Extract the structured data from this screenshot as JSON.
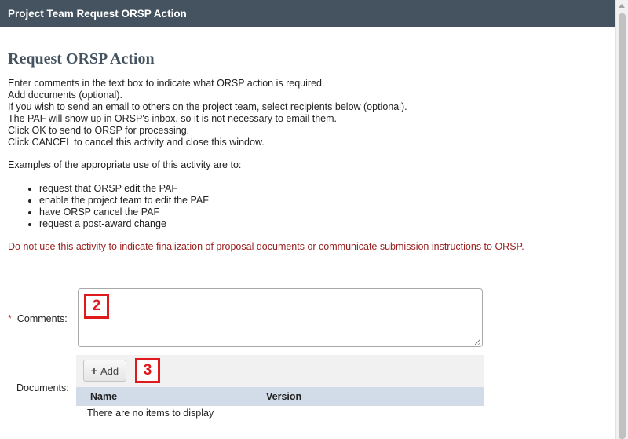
{
  "window": {
    "title": "Project Team Request ORSP Action"
  },
  "page": {
    "heading": "Request ORSP Action",
    "instructions": [
      "Enter comments in the text box to indicate what ORSP action is required.",
      "Add documents (optional).",
      "If you wish to send an email to others on the project team, select recipients below (optional).",
      "The PAF will show up in ORSP's inbox, so it is not necessary to email them.",
      "Click OK to send to ORSP for processing.",
      "Click CANCEL to cancel this activity and close this window."
    ],
    "examples_intro": "Examples of the appropriate use of this activity are to:",
    "examples": [
      "request that ORSP edit the PAF",
      "enable the project team to edit the PAF",
      "have ORSP cancel the PAF",
      "request a post-award change"
    ],
    "warning": "Do not use this activity to indicate finalization of proposal documents or communicate submission instructions to ORSP."
  },
  "form": {
    "comments": {
      "required_marker": "*",
      "label": "Comments:",
      "value": "",
      "badge": "2"
    },
    "documents": {
      "label": "Documents:",
      "add_button_icon": "plus-icon",
      "add_button_label": "Add",
      "badge": "3",
      "columns": [
        "Name",
        "Version"
      ],
      "empty_message": "There are no items to display"
    }
  },
  "colors": {
    "titlebar_bg": "#44535f",
    "warning_text": "#9b2020",
    "badge_border": "#e0191d",
    "grid_header_bg": "#d2dce8",
    "toolbar_bg": "#f1f1f1"
  }
}
